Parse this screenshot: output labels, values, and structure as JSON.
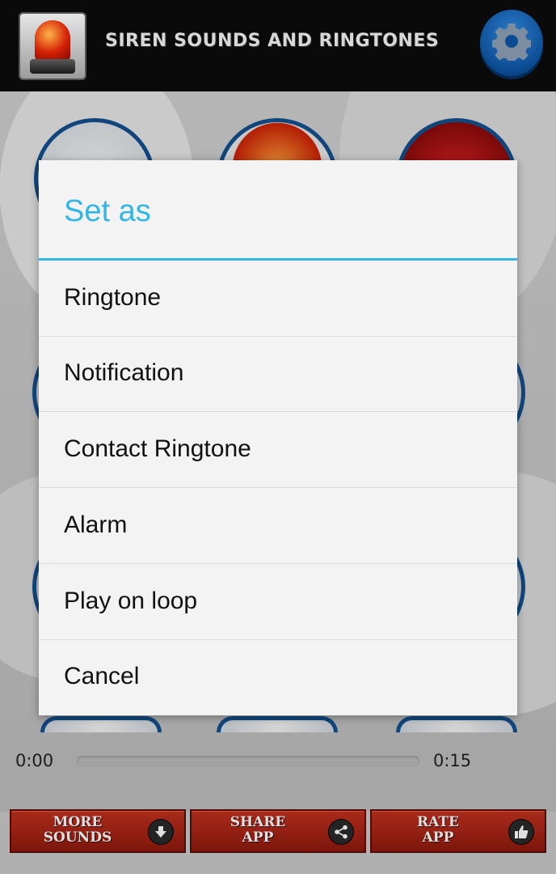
{
  "header": {
    "title": "SIREN SOUNDS AND RINGTONES",
    "app_icon": "siren-icon",
    "settings_icon": "gear-icon"
  },
  "player": {
    "current_time": "0:00",
    "duration": "0:15",
    "progress": 0
  },
  "bottom_buttons": [
    {
      "line1": "MORE",
      "line2": "SOUNDS",
      "icon": "download-icon"
    },
    {
      "line1": "SHARE",
      "line2": "APP",
      "icon": "share-icon"
    },
    {
      "line1": "RATE",
      "line2": "APP",
      "icon": "thumbs-up-icon"
    }
  ],
  "dialog": {
    "title": "Set as",
    "options": [
      "Ringtone",
      "Notification",
      "Contact Ringtone",
      "Alarm",
      "Play on loop",
      "Cancel"
    ]
  },
  "colors": {
    "accent": "#33b5e5",
    "header_bg": "#0a0a0a",
    "button_red": "#b02a18",
    "settings_blue": "#0b4b91"
  }
}
